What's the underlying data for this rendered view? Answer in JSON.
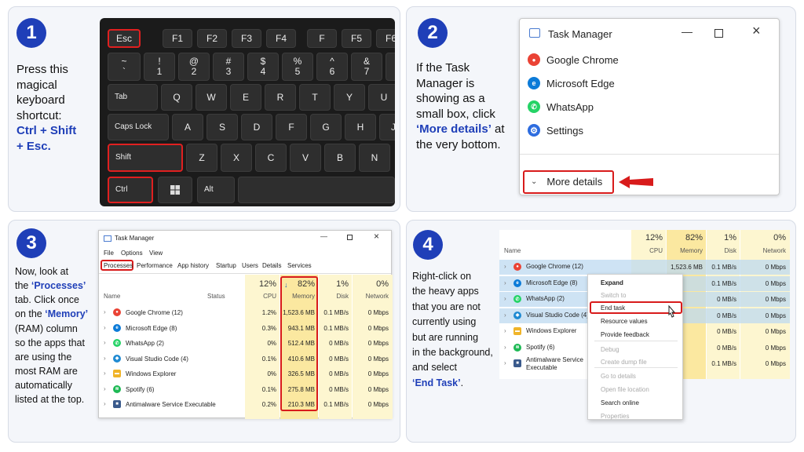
{
  "step1": {
    "number": "1",
    "text_lines": [
      "Press this",
      "magical",
      "keyboard",
      "shortcut:"
    ],
    "highlight_lines": [
      "Ctrl + Shift",
      "+ Esc."
    ],
    "keys": {
      "esc": "Esc",
      "f1": "F1",
      "f2": "F2",
      "f3": "F3",
      "f4": "F4",
      "f_blank": "F",
      "f5": "F5",
      "f6": "F6",
      "tilde": "~",
      "backtick": "`",
      "n1_top": "!",
      "n1": "1",
      "n2_top": "@",
      "n2": "2",
      "n3_top": "#",
      "n3": "3",
      "n4_top": "$",
      "n4": "4",
      "n5_top": "%",
      "n5": "5",
      "n6_top": "^",
      "n6": "6",
      "n7_top": "&",
      "n7": "7",
      "tab": "Tab",
      "q": "Q",
      "w": "W",
      "e": "E",
      "r": "R",
      "t": "T",
      "y": "Y",
      "u": "U",
      "caps": "Caps Lock",
      "a": "A",
      "s": "S",
      "d": "D",
      "f": "F",
      "g": "G",
      "h": "H",
      "j": "J",
      "shift": "Shift",
      "z": "Z",
      "x": "X",
      "c": "C",
      "v": "V",
      "b": "B",
      "n": "N",
      "ctrl": "Ctrl",
      "alt": "Alt"
    }
  },
  "step2": {
    "number": "2",
    "text_lines": [
      "If the Task",
      "Manager is",
      "showing as a",
      "small box, click"
    ],
    "highlight_text": "‘More details’",
    "text_after_highlight": " at",
    "text_end": "the very bottom.",
    "window": {
      "title": "Task Manager",
      "apps": [
        {
          "name": "Google Chrome",
          "icon": "chrome-icon",
          "color": "#ea4335"
        },
        {
          "name": "Microsoft Edge",
          "icon": "edge-icon",
          "color": "#0c7bd8"
        },
        {
          "name": "WhatsApp",
          "icon": "whatsapp-icon",
          "color": "#25d366"
        },
        {
          "name": "Settings",
          "icon": "gear-icon",
          "color": "#2d6cdf"
        }
      ],
      "more_details": "More details"
    }
  },
  "step3": {
    "number": "3",
    "text_lines": [
      "Now, look at",
      "the"
    ],
    "hl_processes": "‘Processes’",
    "text_lines_b": [
      "tab. Click once",
      "on the"
    ],
    "hl_memory": "‘Memory’",
    "text_lines_c": [
      "(RAM) column",
      "so the apps that",
      "are using the",
      "most RAM are",
      "automatically",
      "listed at the top."
    ],
    "window": {
      "title": "Task Manager",
      "menus": [
        "File",
        "Options",
        "View"
      ],
      "tabs": [
        "Processes",
        "Performance",
        "App history",
        "Startup",
        "Users",
        "Details",
        "Services"
      ],
      "col_name": "Name",
      "col_status": "Status",
      "cpu_pct": "12%",
      "cpu_label": "CPU",
      "mem_arrow": "↓",
      "mem_pct": "82%",
      "mem_label": "Memory",
      "disk_pct": "1%",
      "disk_label": "Disk",
      "net_pct": "0%",
      "net_label": "Network",
      "rows": [
        {
          "name": "Google Chrome (12)",
          "icon": "chrome-icon",
          "color": "#ea4335",
          "cpu": "1.2%",
          "mem": "1,523.6 MB",
          "disk": "0.1 MB/s",
          "net": "0 Mbps"
        },
        {
          "name": "Microsoft Edge (8)",
          "icon": "edge-icon",
          "color": "#0c7bd8",
          "cpu": "0.3%",
          "mem": "943.1 MB",
          "disk": "0.1 MB/s",
          "net": "0 Mbps"
        },
        {
          "name": "WhatsApp (2)",
          "icon": "whatsapp-icon",
          "color": "#25d366",
          "cpu": "0%",
          "mem": "512.4 MB",
          "disk": "0 MB/s",
          "net": "0 Mbps"
        },
        {
          "name": "Visual Studio Code (4)",
          "icon": "vscode-icon",
          "color": "#1f8ad2",
          "cpu": "0.1%",
          "mem": "410.6 MB",
          "disk": "0 MB/s",
          "net": "0 Mbps"
        },
        {
          "name": "Windows Explorer",
          "icon": "folder-icon",
          "color": "#f0b429",
          "cpu": "0%",
          "mem": "326.5 MB",
          "disk": "0 MB/s",
          "net": "0 Mbps"
        },
        {
          "name": "Spotify (6)",
          "icon": "spotify-icon",
          "color": "#1db954",
          "cpu": "0.1%",
          "mem": "275.8 MB",
          "disk": "0 MB/s",
          "net": "0 Mbps"
        },
        {
          "name": "Antimalware Service Executable",
          "icon": "shield-icon",
          "color": "#3a5a8c",
          "cpu": "0.2%",
          "mem": "210.3 MB",
          "disk": "0.1 MB/s",
          "net": "0 Mbps"
        }
      ]
    }
  },
  "step4": {
    "number": "4",
    "text_lines": [
      "Right-click on",
      "the heavy apps",
      "that you are not",
      "currently using",
      "but are running",
      "in the background,",
      "and select"
    ],
    "highlight_text": "‘End Task’",
    "text_end": ".",
    "window": {
      "col_name": "Name",
      "cpu_pct": "12%",
      "cpu_label": "CPU",
      "mem_pct": "82%",
      "mem_label": "Memory",
      "disk_pct": "1%",
      "disk_label": "Disk",
      "net_pct": "0%",
      "net_label": "Network",
      "rows": [
        {
          "name": "Google Chrome (12)",
          "icon": "chrome-icon",
          "color": "#ea4335",
          "mem": "1,523.6 MB",
          "disk": "0.1 MB/s",
          "net": "0 Mbps"
        },
        {
          "name": "Microsoft Edge (8)",
          "icon": "edge-icon",
          "color": "#0c7bd8",
          "mem": "",
          "disk": "0.1 MB/s",
          "net": "0 Mbps"
        },
        {
          "name": "WhatsApp (2)",
          "icon": "whatsapp-icon",
          "color": "#25d366",
          "mem": "",
          "disk": "0 MB/s",
          "net": "0 Mbps"
        },
        {
          "name": "Visual Studio Code (4)",
          "icon": "vscode-icon",
          "color": "#1f8ad2",
          "mem": "",
          "disk": "0 MB/s",
          "net": "0 Mbps"
        },
        {
          "name": "Windows Explorer",
          "icon": "folder-icon",
          "color": "#f0b429",
          "mem": "",
          "disk": "0 MB/s",
          "net": "0 Mbps"
        },
        {
          "name": "Spotify (6)",
          "icon": "spotify-icon",
          "color": "#1db954",
          "mem": "",
          "disk": "0 MB/s",
          "net": "0 Mbps"
        },
        {
          "name": "Antimalware Service Executable",
          "icon": "shield-icon",
          "color": "#3a5a8c",
          "mem": "",
          "disk": "0.1 MB/s",
          "net": "0 Mbps"
        }
      ],
      "context_menu": [
        {
          "label": "Expand",
          "bold": true,
          "disabled": false
        },
        {
          "label": "Switch to",
          "bold": false,
          "disabled": true
        },
        {
          "label": "End task",
          "bold": false,
          "disabled": false
        },
        {
          "label": "Resource values",
          "bold": false,
          "disabled": false
        },
        {
          "label": "Provide feedback",
          "bold": false,
          "disabled": false
        },
        {
          "label": "Debug",
          "bold": false,
          "disabled": true
        },
        {
          "label": "Create dump file",
          "bold": false,
          "disabled": true
        },
        {
          "label": "Go to details",
          "bold": false,
          "disabled": true
        },
        {
          "label": "Open file location",
          "bold": false,
          "disabled": true
        },
        {
          "label": "Search online",
          "bold": false,
          "disabled": false
        },
        {
          "label": "Properties",
          "bold": false,
          "disabled": true
        }
      ]
    }
  },
  "colors": {
    "accent_blue": "#1f3fb8",
    "highlight_red": "#d81b1b",
    "memory_yellow": "#fdf0a8",
    "selected_row_blue": "#cfe3f5"
  }
}
